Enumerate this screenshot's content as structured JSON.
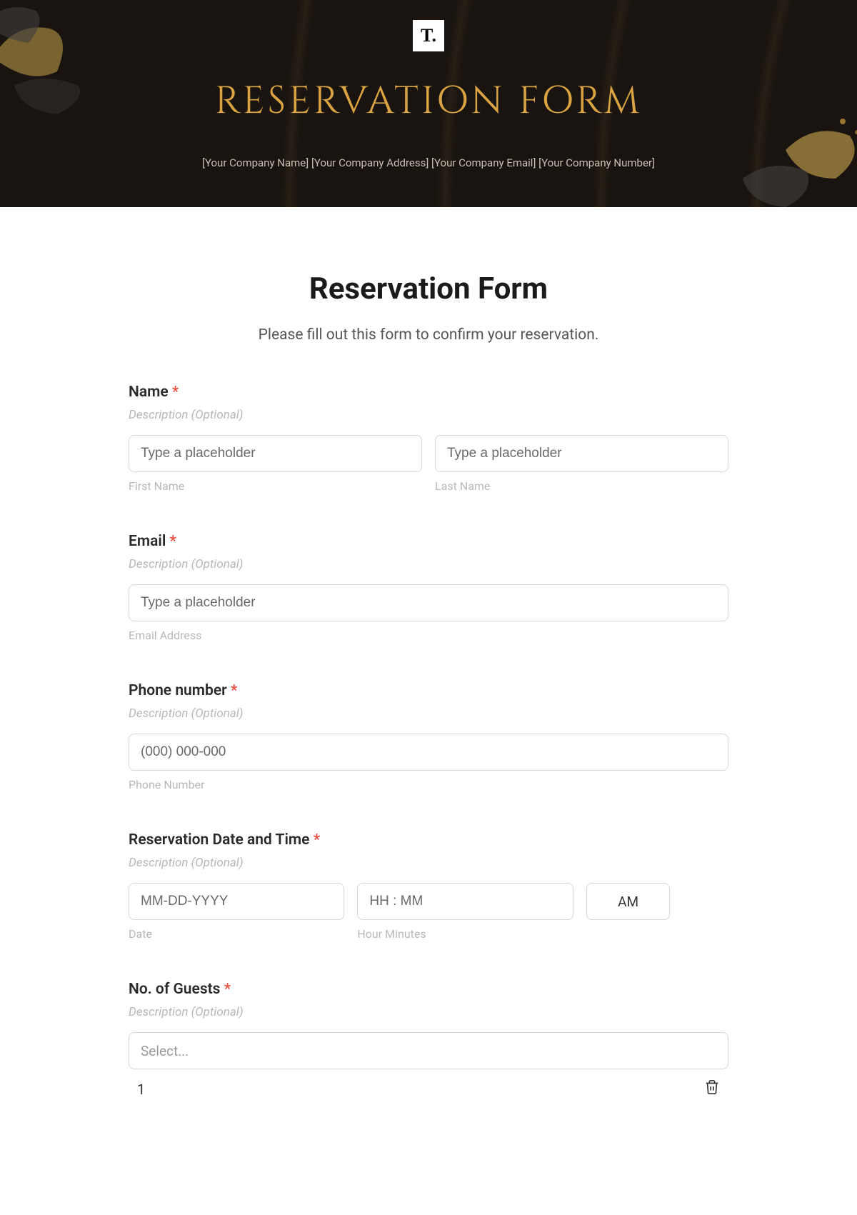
{
  "banner": {
    "logo_text": "T.",
    "title": "RESERVATION FORM",
    "subtitle": "[Your Company Name] [Your Company Address] [Your Company Email] [Your Company Number]"
  },
  "form": {
    "title": "Reservation Form",
    "subtitle": "Please fill out this form to confirm your reservation.",
    "required_mark": "*",
    "description_placeholder": "Description (Optional)",
    "fields": {
      "name": {
        "label": "Name",
        "first_placeholder": "Type a placeholder",
        "first_sublabel": "First Name",
        "last_placeholder": "Type a placeholder",
        "last_sublabel": "Last Name"
      },
      "email": {
        "label": "Email",
        "placeholder": "Type a placeholder",
        "sublabel": "Email Address"
      },
      "phone": {
        "label": "Phone number",
        "placeholder": "(000) 000-000",
        "sublabel": "Phone Number"
      },
      "datetime": {
        "label": "Reservation Date and Time",
        "date_placeholder": "MM-DD-YYYY",
        "date_sublabel": "Date",
        "time_placeholder": "HH : MM",
        "time_sublabel": "Hour Minutes",
        "ampm": "AM"
      },
      "guests": {
        "label": "No. of Guests",
        "select_placeholder": "Select...",
        "option1": "1"
      }
    }
  }
}
